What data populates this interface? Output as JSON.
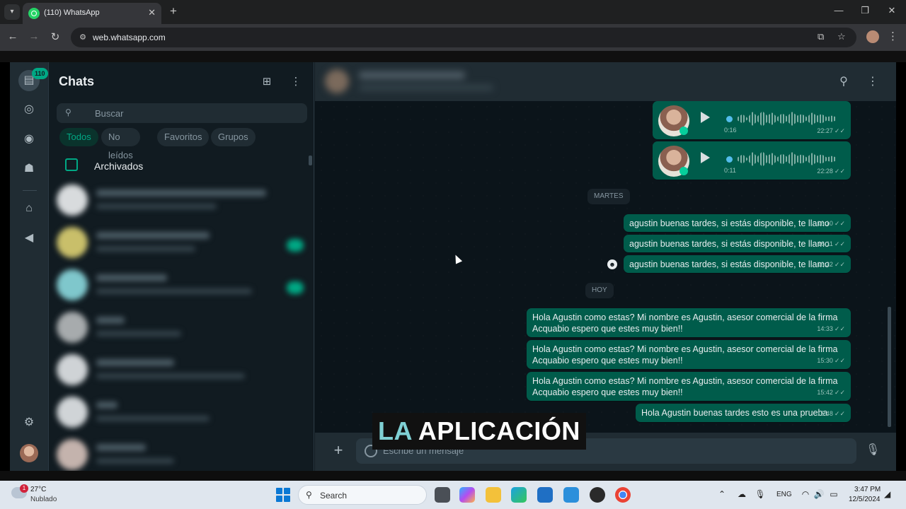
{
  "browser": {
    "tab_title": "(110) WhatsApp",
    "url": "web.whatsapp.com"
  },
  "rail": {
    "unread_count": "110"
  },
  "chatlist": {
    "title": "Chats",
    "search_placeholder": "Buscar",
    "filters": [
      "Todos",
      "No leídos",
      "Favoritos",
      "Grupos"
    ],
    "archived_label": "Archivados"
  },
  "conversation": {
    "voice_notes": [
      {
        "duration": "0:16",
        "time": "22:27"
      },
      {
        "duration": "0:11",
        "time": "22:28"
      }
    ],
    "day_separators": [
      "MARTES",
      "HOY"
    ],
    "messages_martes": [
      {
        "text": "agustin buenas tardes, si estás disponible, te llamo",
        "time": "16:10"
      },
      {
        "text": "agustin buenas tardes, si estás disponible, te llamo",
        "time": "16:11"
      },
      {
        "text": "agustin buenas tardes, si estás disponible, te llamo",
        "time": "16:22"
      }
    ],
    "messages_hoy": [
      {
        "line1": "Hola Agustin como estas? Mi nombre es Agustin, asesor comercial de la firma",
        "line2": "Acquabio espero que estes muy bien!!",
        "time": "14:33"
      },
      {
        "line1": "Hola Agustin como estas? Mi nombre es Agustin, asesor comercial de la firma",
        "line2": "Acquabio espero que estes muy bien!!",
        "time": "15:30"
      },
      {
        "line1": "Hola Agustin como estas? Mi nombre es Agustin, asesor comercial de la firma",
        "line2": "Acquabio espero que estes muy bien!!",
        "time": "15:42"
      },
      {
        "text": "Hola Agustin buenas tardes esto es una prueba",
        "time": "15:48"
      }
    ],
    "input_placeholder": "Escribe un mensaje"
  },
  "caption": {
    "part1": "LA",
    "part2": "APLICACIÓN"
  },
  "taskbar": {
    "weather_temp": "27°C",
    "weather_desc": "Nublado",
    "weather_badge": "1",
    "search_label": "Search",
    "language": "ENG",
    "time": "3:47 PM",
    "date": "12/5/2024"
  },
  "colors": {
    "accent": "#00a884",
    "outgoing_bubble": "#005c4b",
    "panel": "#202c33",
    "background": "#0b141a"
  }
}
